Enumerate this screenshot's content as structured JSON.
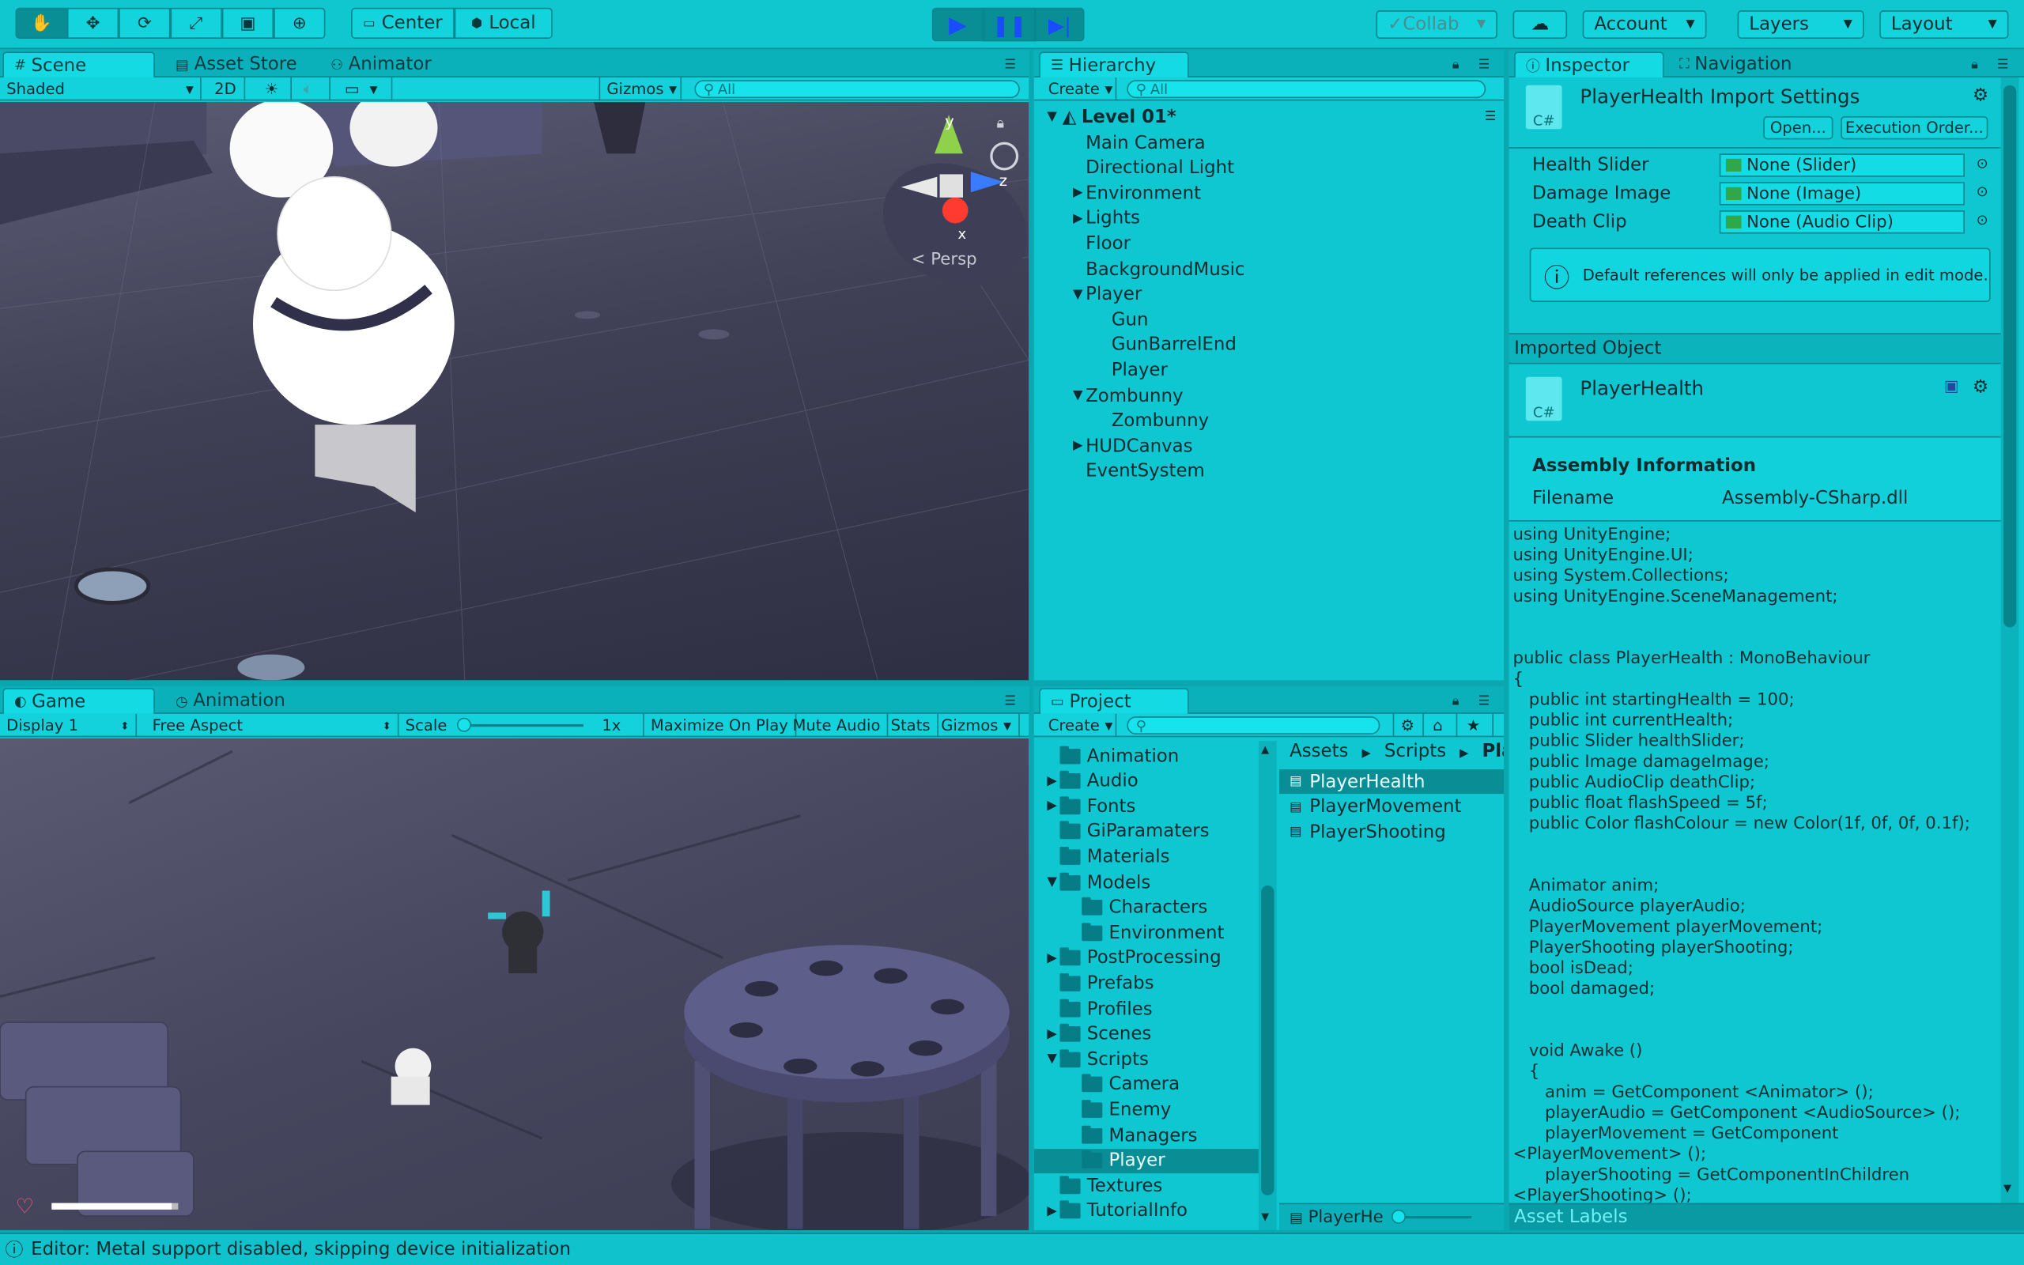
{
  "toolbar": {
    "pivot_center": "Center",
    "pivot_local": "Local",
    "collab": "Collab",
    "account": "Account",
    "layers": "Layers",
    "layout": "Layout"
  },
  "scene": {
    "tabs": [
      "Scene",
      "Asset Store",
      "Animator"
    ],
    "shading": "Shaded",
    "mode_2d": "2D",
    "gizmos": "Gizmos",
    "search_placeholder": "All",
    "persp_label": "Persp",
    "axis_y": "y",
    "axis_z": "z",
    "axis_x": "x"
  },
  "game": {
    "tabs": [
      "Game",
      "Animation"
    ],
    "display": "Display 1",
    "aspect": "Free Aspect",
    "scale_label": "Scale",
    "scale_value": "1x",
    "buttons": [
      "Maximize On Play",
      "Mute Audio",
      "Stats",
      "Gizmos"
    ],
    "health_fraction": 0.95
  },
  "hierarchy": {
    "tab": "Hierarchy",
    "create": "Create",
    "search_placeholder": "All",
    "scene_name": "Level 01*",
    "items": [
      {
        "label": "Main Camera",
        "depth": 1,
        "expander": ""
      },
      {
        "label": "Directional Light",
        "depth": 1,
        "expander": ""
      },
      {
        "label": "Environment",
        "depth": 1,
        "expander": "▶"
      },
      {
        "label": "Lights",
        "depth": 1,
        "expander": "▶"
      },
      {
        "label": "Floor",
        "depth": 1,
        "expander": ""
      },
      {
        "label": "BackgroundMusic",
        "depth": 1,
        "expander": ""
      },
      {
        "label": "Player",
        "depth": 1,
        "expander": "▼"
      },
      {
        "label": "Gun",
        "depth": 2,
        "expander": ""
      },
      {
        "label": "GunBarrelEnd",
        "depth": 2,
        "expander": ""
      },
      {
        "label": "Player",
        "depth": 2,
        "expander": ""
      },
      {
        "label": "Zombunny",
        "depth": 1,
        "expander": "▼"
      },
      {
        "label": "Zombunny",
        "depth": 2,
        "expander": ""
      },
      {
        "label": "HUDCanvas",
        "depth": 1,
        "expander": "▶"
      },
      {
        "label": "EventSystem",
        "depth": 1,
        "expander": ""
      }
    ]
  },
  "project": {
    "tab": "Project",
    "create": "Create",
    "breadcrumb": [
      "Assets",
      "Scripts",
      "Playe"
    ],
    "folders": [
      {
        "label": "Animation",
        "depth": 1,
        "expander": ""
      },
      {
        "label": "Audio",
        "depth": 1,
        "expander": "▶"
      },
      {
        "label": "Fonts",
        "depth": 1,
        "expander": "▶"
      },
      {
        "label": "GiParamaters",
        "depth": 1,
        "expander": ""
      },
      {
        "label": "Materials",
        "depth": 1,
        "expander": ""
      },
      {
        "label": "Models",
        "depth": 1,
        "expander": "▼"
      },
      {
        "label": "Characters",
        "depth": 2,
        "expander": ""
      },
      {
        "label": "Environment",
        "depth": 2,
        "expander": ""
      },
      {
        "label": "PostProcessing",
        "depth": 1,
        "expander": "▶"
      },
      {
        "label": "Prefabs",
        "depth": 1,
        "expander": ""
      },
      {
        "label": "Profiles",
        "depth": 1,
        "expander": ""
      },
      {
        "label": "Scenes",
        "depth": 1,
        "expander": "▶"
      },
      {
        "label": "Scripts",
        "depth": 1,
        "expander": "▼"
      },
      {
        "label": "Camera",
        "depth": 2,
        "expander": ""
      },
      {
        "label": "Enemy",
        "depth": 2,
        "expander": ""
      },
      {
        "label": "Managers",
        "depth": 2,
        "expander": ""
      },
      {
        "label": "Player",
        "depth": 2,
        "expander": ""
      },
      {
        "label": "Textures",
        "depth": 1,
        "expander": ""
      },
      {
        "label": "TutorialInfo",
        "depth": 1,
        "expander": "▶"
      }
    ],
    "selected_folder": "Player",
    "files": [
      "PlayerHealth",
      "PlayerMovement",
      "PlayerShooting"
    ],
    "selected_file": "PlayerHealth",
    "footer_file": "PlayerHe"
  },
  "inspector": {
    "tabs": [
      "Inspector",
      "Navigation"
    ],
    "title": "PlayerHealth Import Settings",
    "open": "Open...",
    "execution_order": "Execution Order...",
    "fields": [
      {
        "label": "Health Slider",
        "value": "None (Slider)"
      },
      {
        "label": "Damage Image",
        "value": "None (Image)"
      },
      {
        "label": "Death Clip",
        "value": "None (Audio Clip)"
      }
    ],
    "info": "Default references will only be applied in edit mode.",
    "imported_object": "Imported Object",
    "object_name": "PlayerHealth",
    "assembly_heading": "Assembly Information",
    "filename_label": "Filename",
    "filename_value": "Assembly-CSharp.dll",
    "code": "using UnityEngine;\nusing UnityEngine.UI;\nusing System.Collections;\nusing UnityEngine.SceneManagement;\n\n\npublic class PlayerHealth : MonoBehaviour\n{\n   public int startingHealth = 100;\n   public int currentHealth;\n   public Slider healthSlider;\n   public Image damageImage;\n   public AudioClip deathClip;\n   public float flashSpeed = 5f;\n   public Color flashColour = new Color(1f, 0f, 0f, 0.1f);\n\n\n   Animator anim;\n   AudioSource playerAudio;\n   PlayerMovement playerMovement;\n   PlayerShooting playerShooting;\n   bool isDead;\n   bool damaged;\n\n\n   void Awake ()\n   {\n      anim = GetComponent <Animator> ();\n      playerAudio = GetComponent <AudioSource> ();\n      playerMovement = GetComponent\n<PlayerMovement> ();\n      playerShooting = GetComponentInChildren\n<PlayerShooting> ();",
    "asset_labels": "Asset Labels"
  },
  "status": {
    "message": "Editor: Metal support disabled, skipping device initialization"
  },
  "colors": {
    "accent": "#10c6cf",
    "panel": "#0fc7d0",
    "selection": "#0a8e96"
  }
}
